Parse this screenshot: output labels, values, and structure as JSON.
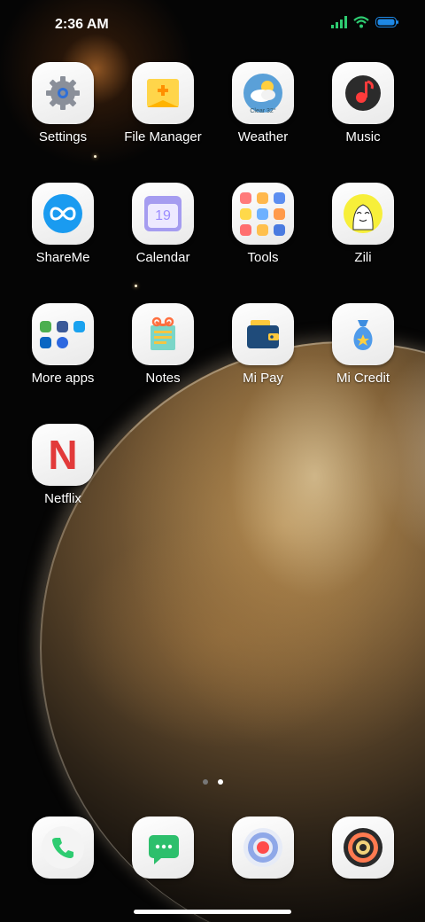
{
  "status_bar": {
    "time": "2:36 AM"
  },
  "home": {
    "apps": [
      {
        "label": "Settings"
      },
      {
        "label": "File Manager"
      },
      {
        "label": "Weather",
        "icon_text": "Clear 32°"
      },
      {
        "label": "Music"
      },
      {
        "label": "ShareMe"
      },
      {
        "label": "Calendar",
        "icon_text": "19"
      },
      {
        "label": "Tools"
      },
      {
        "label": "Zili"
      },
      {
        "label": "More apps"
      },
      {
        "label": "Notes"
      },
      {
        "label": "Mi Pay"
      },
      {
        "label": "Mi Credit"
      },
      {
        "label": "Netflix",
        "icon_text": "N"
      }
    ],
    "page_count": 2,
    "active_page": 2
  },
  "dock": {
    "apps": [
      {
        "icon": "phone-icon"
      },
      {
        "icon": "messages-icon"
      },
      {
        "icon": "browser-icon"
      },
      {
        "icon": "camera-icon"
      }
    ]
  },
  "colors": {
    "accent_green": "#2ecc71",
    "battery_blue": "#1e88e5",
    "netflix_red": "#e23a3a"
  }
}
